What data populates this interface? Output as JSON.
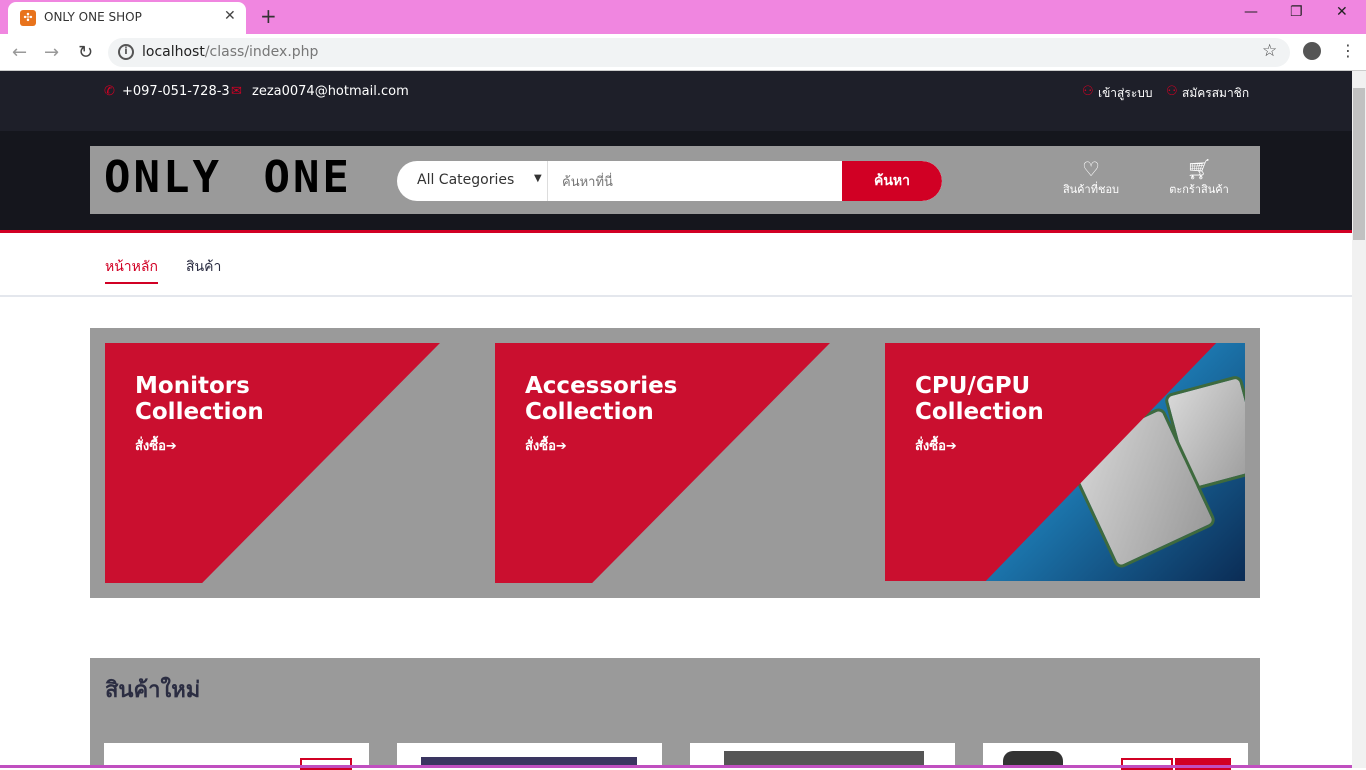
{
  "browser": {
    "tab_title": "ONLY ONE SHOP",
    "url_host": "localhost",
    "url_path": "/class/index.php"
  },
  "topbar": {
    "phone": "+097-051-728-3",
    "email": "zeza0074@hotmail.com",
    "login": "เข้าสู่ระบบ",
    "register": "สมัครสมาชิก"
  },
  "header": {
    "logo": "ONLY ONE",
    "category": "All Categories",
    "search_placeholder": "ค้นหาที่นี่",
    "search_button": "ค้นหา",
    "wishlist": "สินค้าที่ชอบ",
    "cart": "ตะกร้าสินค้า"
  },
  "nav": [
    {
      "label": "หน้าหลัก"
    },
    {
      "label": "สินค้า"
    }
  ],
  "collections": [
    {
      "line1": "Monitors",
      "line2": "Collection",
      "cta": "สั่งซื้อ"
    },
    {
      "line1": "Accessories",
      "line2": "Collection",
      "cta": "สั่งซื้อ"
    },
    {
      "line1": "CPU/GPU",
      "line2": "Collection",
      "cta": "สั่งซื้อ"
    }
  ],
  "new_products": {
    "title": "สินค้าใหม่"
  },
  "colors": {
    "accent": "#d10024",
    "dark": "#1e1f29"
  }
}
